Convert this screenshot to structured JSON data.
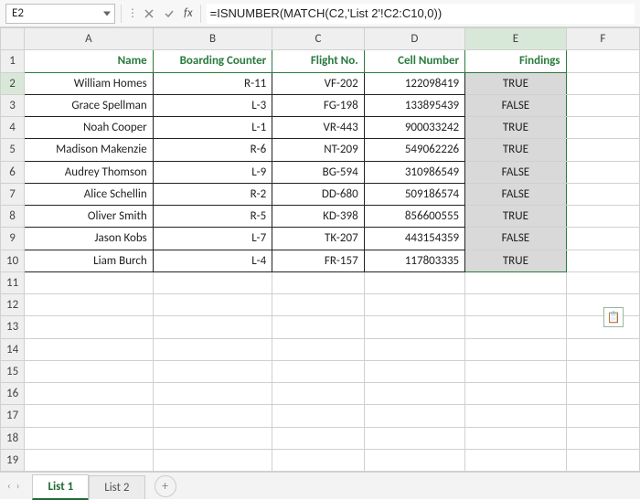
{
  "formula_bar": {
    "cell_ref": "E2",
    "fx_label": "fx",
    "formula": "=ISNUMBER(MATCH(C2,'List 2'!C2:C10,0))"
  },
  "columns": [
    "A",
    "B",
    "C",
    "D",
    "E",
    "F"
  ],
  "row_numbers": [
    "1",
    "2",
    "3",
    "4",
    "5",
    "6",
    "7",
    "8",
    "9",
    "10",
    "11",
    "12",
    "13",
    "14",
    "15",
    "16",
    "17",
    "18",
    "19"
  ],
  "headers": {
    "A": "Name",
    "B": "Boarding Counter",
    "C": "Flight No.",
    "D": "Cell Number",
    "E": "Findings"
  },
  "rows": [
    {
      "A": "William Homes",
      "B": "R-11",
      "C": "VF-202",
      "D": "122098419",
      "E": "TRUE"
    },
    {
      "A": "Grace Spellman",
      "B": "L-3",
      "C": "FG-198",
      "D": "133895439",
      "E": "FALSE"
    },
    {
      "A": "Noah Cooper",
      "B": "L-1",
      "C": "VR-443",
      "D": "900033242",
      "E": "TRUE"
    },
    {
      "A": "Madison Makenzie",
      "B": "R-6",
      "C": "NT-209",
      "D": "549062226",
      "E": "TRUE"
    },
    {
      "A": "Audrey Thomson",
      "B": "L-9",
      "C": "BG-594",
      "D": "310986549",
      "E": "FALSE"
    },
    {
      "A": "Alice Schellin",
      "B": "R-2",
      "C": "DD-680",
      "D": "509186574",
      "E": "FALSE"
    },
    {
      "A": "Oliver Smith",
      "B": "R-5",
      "C": "KD-398",
      "D": "856600555",
      "E": "TRUE"
    },
    {
      "A": "Jason Kobs",
      "B": "L-7",
      "C": "TK-207",
      "D": "443154359",
      "E": "FALSE"
    },
    {
      "A": "Liam Burch",
      "B": "L-4",
      "C": "FR-157",
      "D": "117803335",
      "E": "TRUE"
    }
  ],
  "tabs": {
    "active": "List 1",
    "inactive": "List 2",
    "add": "+"
  },
  "nav_arrows": {
    "first": "◄",
    "prev": "‹",
    "next": "›",
    "last": "►"
  },
  "paste_icon": "📋"
}
